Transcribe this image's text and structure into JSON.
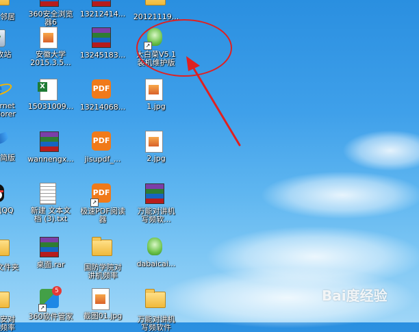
{
  "desktop": {
    "icons": [
      {
        "id": "c1r0",
        "label": "网上邻居"
      },
      {
        "id": "c2r0",
        "label": "360安全浏览\n器6"
      },
      {
        "id": "c3r0",
        "label": "13212414..."
      },
      {
        "id": "c4r0",
        "label": "20121119..."
      },
      {
        "id": "c1r1",
        "label": "回收站"
      },
      {
        "id": "c2r1",
        "label": "安徽大学\n2015.3.5..."
      },
      {
        "id": "c3r1",
        "label": "13245183..."
      },
      {
        "id": "c4r1",
        "label": "大白菜V5.1\n装机维护版"
      },
      {
        "id": "c1r2",
        "label": "Internet\nExplorer"
      },
      {
        "id": "c2r2",
        "label": "15031009..."
      },
      {
        "id": "c3r2",
        "label": "13214068..."
      },
      {
        "id": "c4r2",
        "label": "1.jpg"
      },
      {
        "id": "c1r3",
        "label": "雷精简版"
      },
      {
        "id": "c2r3",
        "label": "wannengx..."
      },
      {
        "id": "c3r3",
        "label": "jisupdf_..."
      },
      {
        "id": "c4r3",
        "label": "2.jpg"
      },
      {
        "id": "c1r4",
        "label": "腾讯QQ"
      },
      {
        "id": "c2r4",
        "label": "新建 文本文\n档 (3).txt"
      },
      {
        "id": "c3r4",
        "label": "极速PDF阅读\n器"
      },
      {
        "id": "c4r4",
        "label": "万能对讲机\n写频软..."
      },
      {
        "id": "c1r5",
        "label": "新建文件夹"
      },
      {
        "id": "c2r5",
        "label": "桌面.rar"
      },
      {
        "id": "c3r5",
        "label": "国防学院对\n讲机频率"
      },
      {
        "id": "c4r5",
        "label": "dabaicai..."
      },
      {
        "id": "c1r6",
        "label": "话保安对\n讲机频率"
      },
      {
        "id": "c2r6",
        "label": "360软件管家"
      },
      {
        "id": "c3r6",
        "label": "截图01.jpg"
      },
      {
        "id": "c4r6",
        "label": "万能对讲机\n写频软件"
      }
    ]
  },
  "icon_names": {
    "recycle": "recycle-bin-icon",
    "ie": "internet-explorer-icon",
    "thunder": "thunder-bird-icon",
    "qq": "qq-penguin-icon",
    "folder": "folder-icon",
    "winrar": "winrar-archive-icon",
    "pdf": "pdf-reader-icon",
    "jpg": "image-file-icon",
    "excel": "excel-file-icon",
    "txt": "text-file-icon",
    "cabbage": "dabaicai-cabbage-icon",
    "mgr": "360-software-manager-icon"
  },
  "annotation": {
    "color": "#e02020",
    "shape": "circle-and-arrow"
  },
  "watermark": {
    "text": "Bai度经验",
    "url_hint": "jingyan.baidu.com"
  },
  "colors": {
    "sky_top": "#2a8fe0",
    "sky_bottom": "#9fd6f7",
    "label_text": "#ffffff"
  }
}
